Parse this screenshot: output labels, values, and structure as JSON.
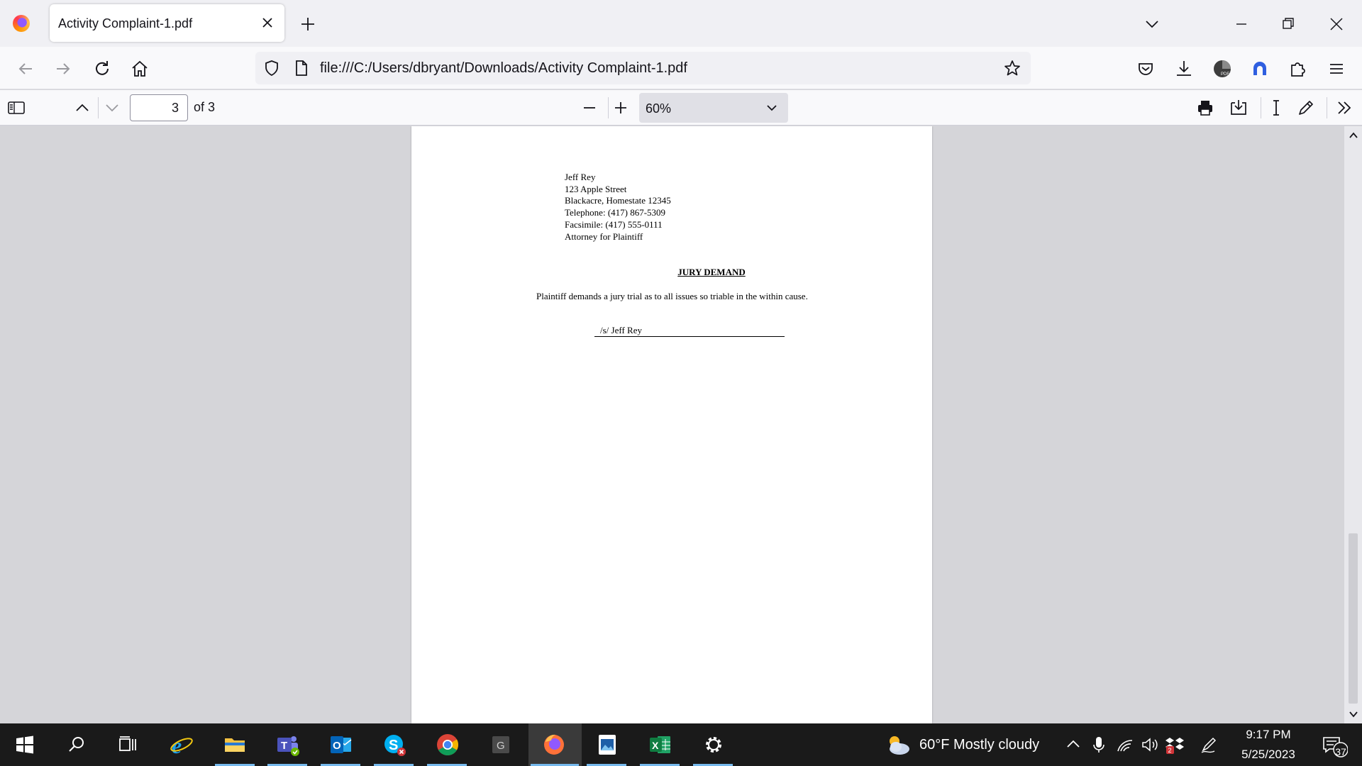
{
  "browser": {
    "tab_title": "Activity Complaint-1.pdf",
    "url": "file:///C:/Users/dbryant/Downloads/Activity Complaint-1.pdf"
  },
  "pdf_toolbar": {
    "page_number": "3",
    "page_count_label": "of 3",
    "zoom": "60%"
  },
  "document": {
    "address_lines": [
      "Jeff Rey",
      "123 Apple Street",
      "Blackacre, Homestate 12345",
      "Telephone: (417) 867-5309",
      "Facsimile: (417) 555-0111",
      "Attorney for Plaintiff"
    ],
    "heading": "JURY DEMAND",
    "body": "Plaintiff demands a jury trial as to all issues so triable in the within cause.",
    "signature": "/s/ Jeff Rey"
  },
  "taskbar": {
    "weather": "60°F  Mostly cloudy",
    "time": "9:17 PM",
    "date": "5/25/2023",
    "notification_count": "37",
    "active_app": "firefox",
    "pinned_apps": [
      "start",
      "search",
      "task-view",
      "internet-explorer",
      "file-explorer",
      "teams",
      "outlook",
      "skype",
      "chrome",
      "g-app",
      "firefox",
      "photos",
      "excel",
      "settings"
    ]
  },
  "colors": {
    "accent": "#0061e0",
    "taskbar_bg": "#1a1a1a",
    "viewer_bg": "#d5d5d9"
  }
}
